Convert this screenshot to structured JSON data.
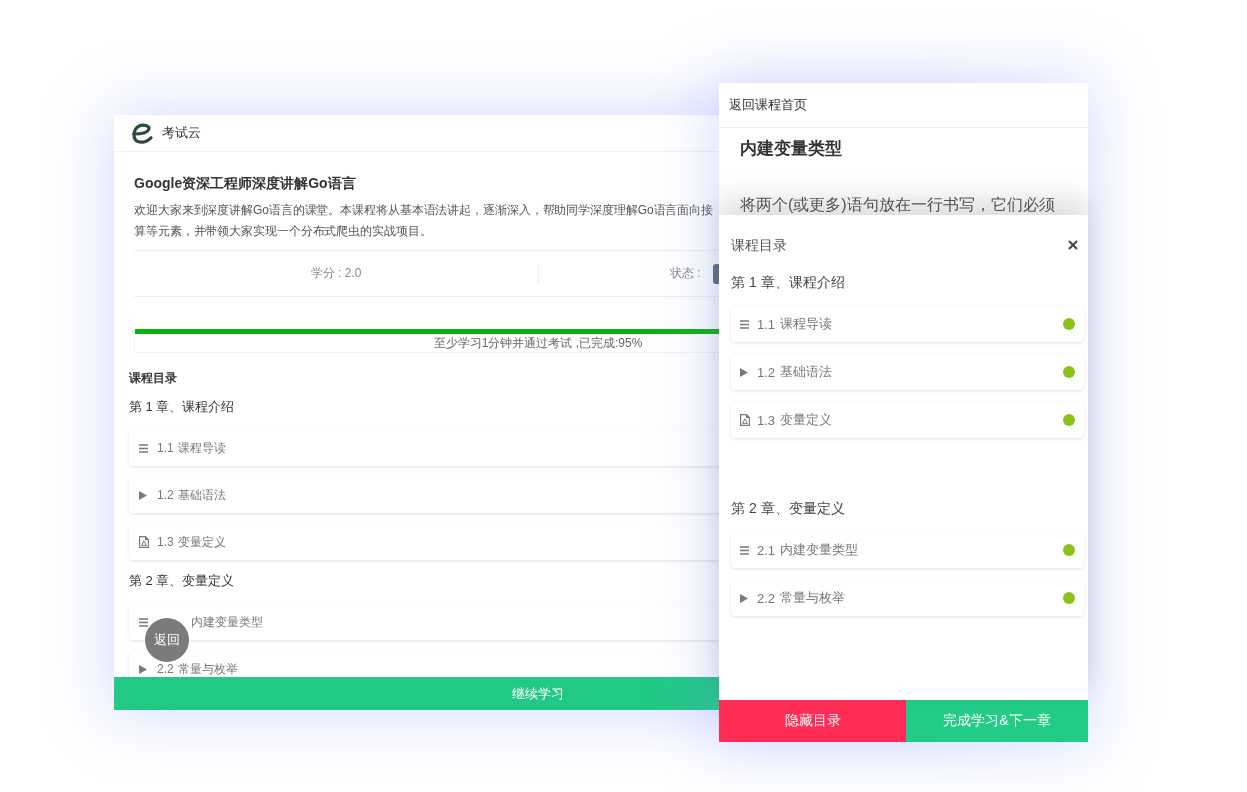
{
  "course_page": {
    "brand": "考试云",
    "title": "Google资深工程师深度讲解Go语言",
    "description_lines": [
      "欢迎大家来到深度讲解Go语言的课堂。本课程将从基本语法讲起，逐渐深入，帮助同学深度理解Go语言面向接",
      "算等元素，并带领大家实现一个分布式爬虫的实战项目。"
    ],
    "credit": "学分 : 2.0",
    "status_label": "状态 :",
    "progress": {
      "level": 0.95,
      "caption": "至少学习1分钟并通过考试 ,已完成:95%"
    },
    "catalog_title": "课程目录",
    "chapters": [
      {
        "title": "第 1 章、课程介绍",
        "lessons": [
          {
            "kind": "article",
            "number": "1.1",
            "title": "课程导读"
          },
          {
            "kind": "video",
            "number": "1.2",
            "title": "基础语法"
          },
          {
            "kind": "document",
            "number": "1.3",
            "title": "变量定义"
          }
        ]
      },
      {
        "title": "第 2 章、变量定义",
        "lessons": [
          {
            "kind": "article",
            "title": "内建变量类型"
          },
          {
            "kind": "video",
            "number": "2.2",
            "title": "常量与枚举"
          }
        ]
      }
    ],
    "continue_button": "继续学习",
    "back_button": "返回"
  },
  "lesson_page": {
    "back_link": "返回课程首页",
    "lesson_title": "内建变量类型",
    "lesson_excerpt": "将两个(或更多)语句放在一行书写，它们必须",
    "catalog": {
      "title": "课程目录",
      "chapters": [
        {
          "title": "第 1 章、课程介绍",
          "lessons": [
            {
              "kind": "article",
              "number": "1.1",
              "title": "课程导读",
              "completed": true
            },
            {
              "kind": "video",
              "number": "1.2",
              "title": "基础语法",
              "completed": true
            },
            {
              "kind": "document",
              "number": "1.3",
              "title": "变量定义",
              "completed": true
            }
          ]
        },
        {
          "title": "第 2 章、变量定义",
          "lessons": [
            {
              "kind": "article",
              "number": "2.1",
              "title": "内建变量类型",
              "completed": true
            },
            {
              "kind": "video",
              "number": "2.2",
              "title": "常量与枚举",
              "completed": true
            }
          ]
        }
      ]
    },
    "buttons": [
      {
        "kind": "hide_catalog",
        "label": "隐藏目录"
      },
      {
        "kind": "complete_next",
        "label": "完成学习&下一章"
      }
    ]
  }
}
